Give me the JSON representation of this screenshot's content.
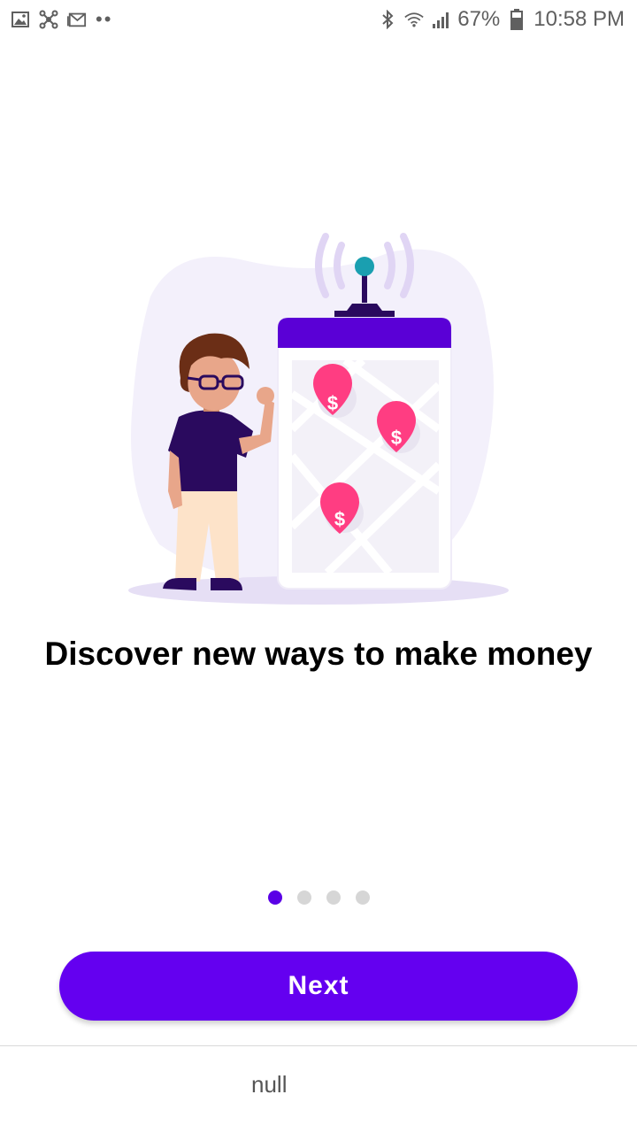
{
  "status_bar": {
    "battery": "67%",
    "time": "10:58 PM",
    "left_icons": [
      "image-icon",
      "network-icon",
      "gmail-icon"
    ],
    "more": "••"
  },
  "onboarding": {
    "title": "Discover new ways to make money",
    "pages_total": 4,
    "current_page": 1,
    "next_label": "Next"
  },
  "footer": {
    "text": "null"
  },
  "colors": {
    "accent": "#6400f0",
    "pin": "#ff3d82",
    "dot_inactive": "#d6d6d6"
  }
}
